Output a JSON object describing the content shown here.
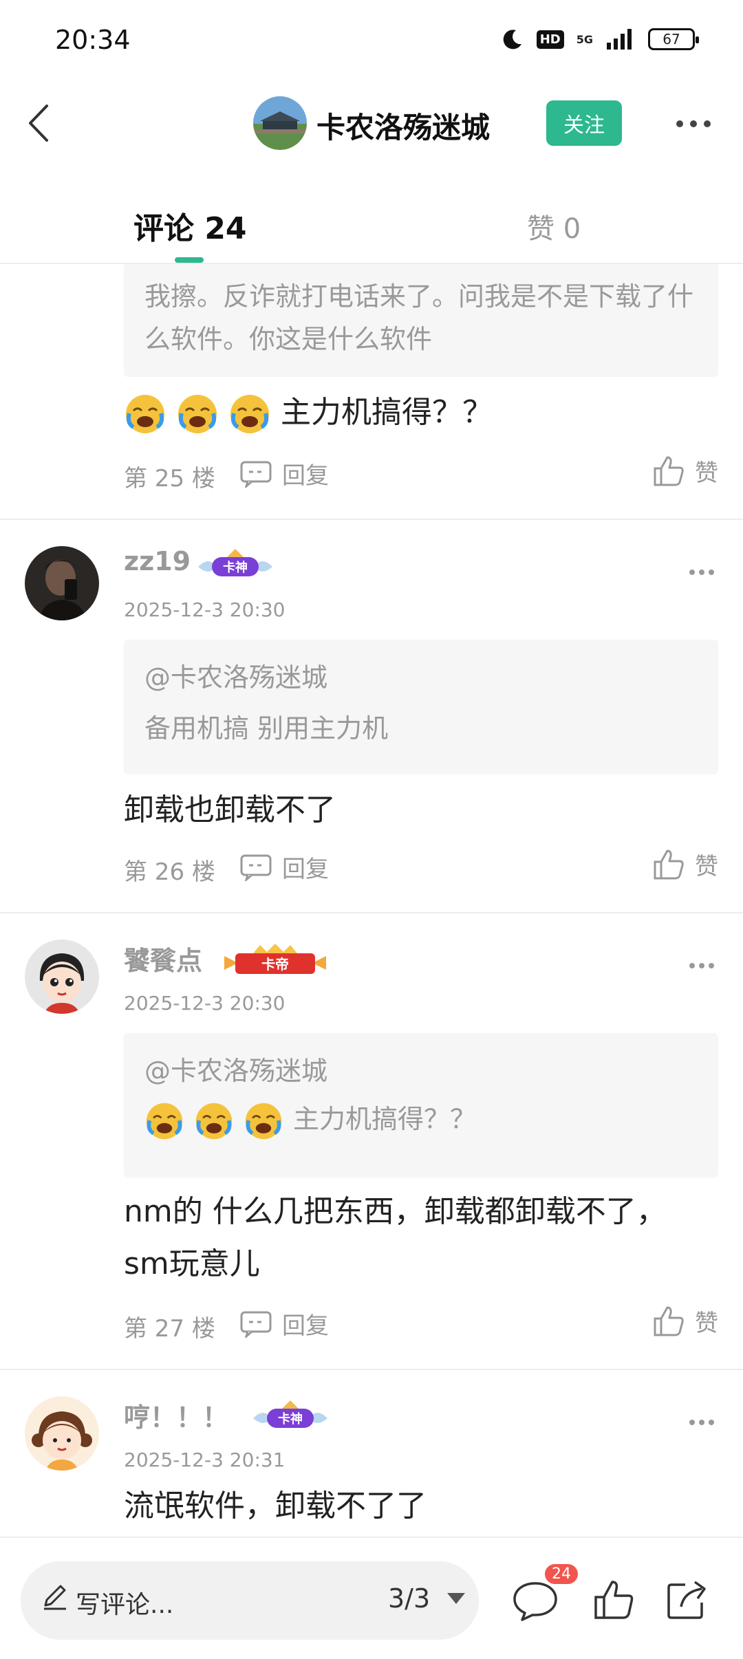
{
  "status_bar": {
    "time": "20:34",
    "hd": "HD",
    "network": "5G",
    "battery": "67"
  },
  "header": {
    "title": "卡农洛殇迷城",
    "follow_label": "关注"
  },
  "tabs": {
    "comments_label": "评论 24",
    "likes_label": "赞 0"
  },
  "comments": [
    {
      "quote_text": "我擦。反诈就打电话来了。问我是不是下载了什么软件。你这是什么软件",
      "emoji_count": 3,
      "text": "主力机搞得？？",
      "floor": "第 25 楼",
      "reply_label": "回复",
      "like_label": "赞"
    },
    {
      "username": "zz19",
      "badge": "卡神",
      "timestamp": "2025-12-3 20:30",
      "quote_mention": "@卡农洛殇迷城",
      "quote_text": "备用机搞 别用主力机",
      "text": "卸载也卸载不了",
      "floor": "第 26 楼",
      "reply_label": "回复",
      "like_label": "赞"
    },
    {
      "username": "饕餮点",
      "badge": "卡帝",
      "timestamp": "2025-12-3 20:30",
      "quote_mention": "@卡农洛殇迷城",
      "quote_emoji_count": 3,
      "quote_text": "主力机搞得？？",
      "text_line1": "nm的 什么几把东西，卸载都卸载不了，",
      "text_line2": "sm玩意儿",
      "floor": "第 27 楼",
      "reply_label": "回复",
      "like_label": "赞"
    },
    {
      "username": "哼！！！",
      "badge": "卡神",
      "timestamp": "2025-12-3 20:31",
      "text": "流氓软件，卸载不了了"
    }
  ],
  "bottom_bar": {
    "write_placeholder": "写评论...",
    "page_indicator": "3/3",
    "comment_count": "24"
  },
  "colors": {
    "accent": "#2db88f",
    "notification": "#f2554e",
    "muted_text": "#999999"
  },
  "icons": [
    "back-icon",
    "more-icon",
    "reply-icon",
    "like-icon",
    "pencil-icon",
    "caret-down-icon",
    "comment-icon",
    "thumb-up-icon",
    "share-icon",
    "crying-laughing-emoji"
  ]
}
